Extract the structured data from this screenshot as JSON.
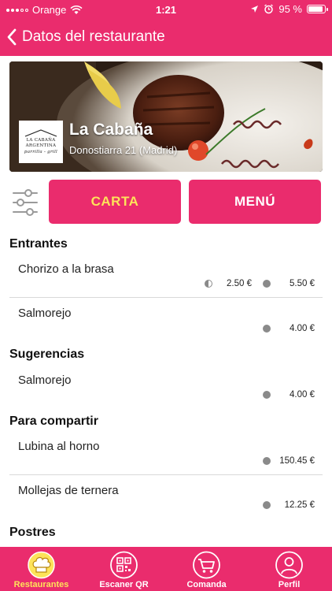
{
  "status_bar": {
    "carrier": "Orange",
    "time": "1:21",
    "battery": "95 %",
    "battery_level": 0.95
  },
  "nav": {
    "title": "Datos del restaurante"
  },
  "restaurant": {
    "name": "La Cabaña",
    "address": "Donostiarra 21 (Madrid)",
    "logo_lines": [
      "LA CABAÑA",
      "ARGENTINA",
      "parrilla - grill"
    ]
  },
  "tabs": {
    "carta": "CARTA",
    "menu": "MENÚ"
  },
  "sections": {
    "entrantes": {
      "title": "Entrantes",
      "items": [
        {
          "name": "Chorizo a la brasa",
          "price_half": "2.50 €",
          "price_full": "5.50 €"
        },
        {
          "name": "Salmorejo",
          "price_full": "4.00 €"
        }
      ]
    },
    "sugerencias": {
      "title": "Sugerencias",
      "items": [
        {
          "name": "Salmorejo",
          "price_full": "4.00 €"
        }
      ]
    },
    "para_compartir": {
      "title": "Para compartir",
      "items": [
        {
          "name": "Lubina al horno",
          "price_full": "150.45 €"
        },
        {
          "name": "Mollejas de ternera",
          "price_full": "12.25 €"
        }
      ]
    },
    "postres": {
      "title": "Postres"
    }
  },
  "bottom_tabs": [
    {
      "label": "Restaurantes",
      "icon": "chef-hat-icon",
      "active": true
    },
    {
      "label": "Escaner QR",
      "icon": "qr-code-icon",
      "active": false
    },
    {
      "label": "Comanda",
      "icon": "shopping-cart-icon",
      "active": false
    },
    {
      "label": "Perfil",
      "icon": "user-icon",
      "active": false
    }
  ],
  "colors": {
    "accent": "#ea2c6d",
    "active_label": "#fde35a",
    "price_dot": "#8a8a8a"
  }
}
